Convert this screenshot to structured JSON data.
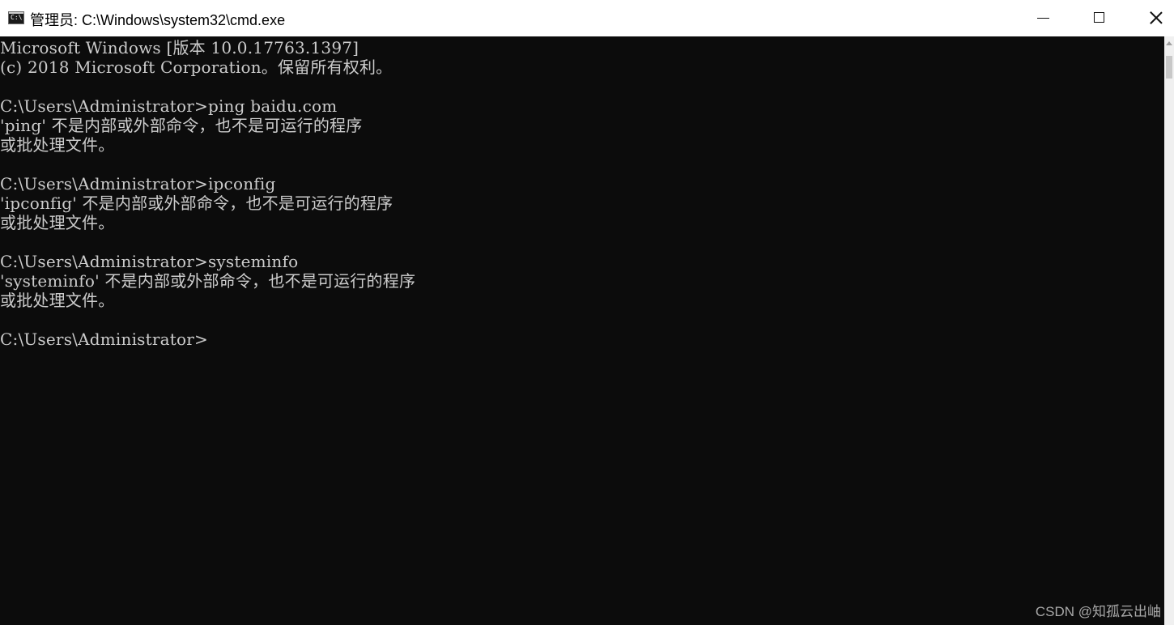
{
  "window": {
    "title": "管理员: C:\\Windows\\system32\\cmd.exe",
    "icon": "cmd-icon",
    "icon_text": "C:\\"
  },
  "controls": {
    "minimize": "minimize-icon",
    "maximize": "maximize-icon",
    "close": "close-icon"
  },
  "console": {
    "lines": [
      "Microsoft Windows [版本 10.0.17763.1397]",
      "(c) 2018 Microsoft Corporation。保留所有权利。",
      "",
      "C:\\Users\\Administrator>ping baidu.com",
      "'ping' 不是内部或外部命令，也不是可运行的程序",
      "或批处理文件。",
      "",
      "C:\\Users\\Administrator>ipconfig",
      "'ipconfig' 不是内部或外部命令，也不是可运行的程序",
      "或批处理文件。",
      "",
      "C:\\Users\\Administrator>systeminfo",
      "'systeminfo' 不是内部或外部命令，也不是可运行的程序",
      "或批处理文件。",
      "",
      "C:\\Users\\Administrator>"
    ],
    "foreground": "#cccccc",
    "background": "#0c0c0c"
  },
  "watermark": "CSDN @知孤云出岫"
}
